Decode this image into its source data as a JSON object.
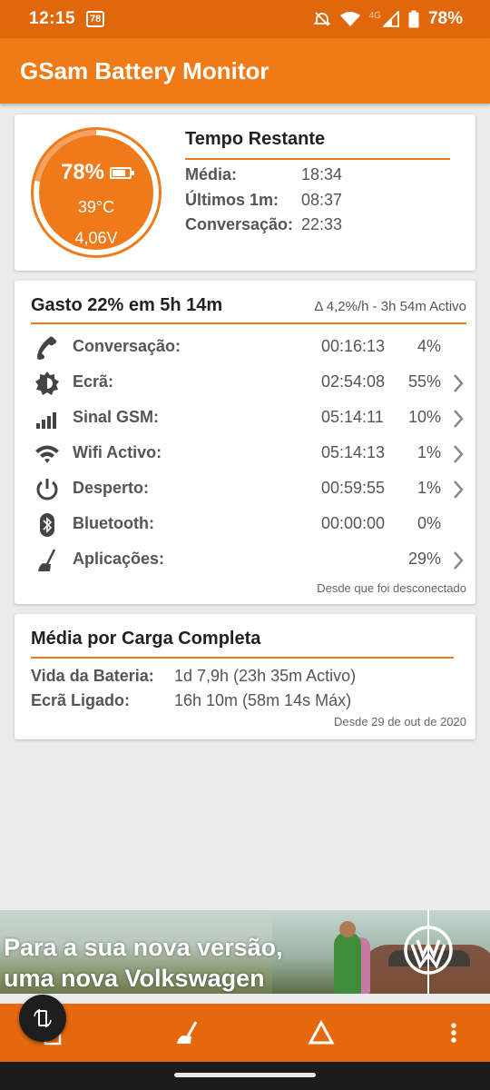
{
  "status_bar": {
    "time": "12:15",
    "notification_badge": "78",
    "network_label": "4G",
    "battery_percent": "78%"
  },
  "app_bar": {
    "title": "GSam Battery Monitor"
  },
  "battery_card": {
    "percent": "78%",
    "level_fraction": 0.78,
    "temperature": "39°C",
    "voltage": "4,06V",
    "title": "Tempo Restante",
    "rows": [
      {
        "label": "Média:",
        "value": "18:34"
      },
      {
        "label": "Últimos 1m:",
        "value": "08:37"
      },
      {
        "label": "Conversação:",
        "value": "22:33"
      }
    ]
  },
  "usage_card": {
    "title": "Gasto 22% em 5h 14m",
    "subtitle": "Δ 4,2%/h - 3h 54m Activo",
    "rows": [
      {
        "icon": "phone-icon",
        "label": "Conversação:",
        "duration": "00:16:13",
        "percent": "4%",
        "has_chevron": false
      },
      {
        "icon": "screen-brightness-icon",
        "label": "Ecrã:",
        "duration": "02:54:08",
        "percent": "55%",
        "has_chevron": true
      },
      {
        "icon": "signal-bars-icon",
        "label": "Sinal GSM:",
        "duration": "05:14:11",
        "percent": "10%",
        "has_chevron": true
      },
      {
        "icon": "wifi-icon",
        "label": "Wifi Activo:",
        "duration": "05:14:13",
        "percent": "1%",
        "has_chevron": true
      },
      {
        "icon": "power-icon",
        "label": "Desperto:",
        "duration": "00:59:55",
        "percent": "1%",
        "has_chevron": true
      },
      {
        "icon": "bluetooth-icon",
        "label": "Bluetooth:",
        "duration": "00:00:00",
        "percent": "0%",
        "has_chevron": false
      },
      {
        "icon": "apps-broom-icon",
        "label": "Aplicações:",
        "duration": "",
        "percent": "29%",
        "has_chevron": true
      }
    ],
    "footer": "Desde que foi desconectado"
  },
  "average_card": {
    "title": "Média por Carga Completa",
    "rows": [
      {
        "label": "Vida da Bateria:",
        "value": "1d 7,9h (23h 35m Activo)"
      },
      {
        "label": "Ecrã Ligado:",
        "value": "16h 10m (58m 14s Máx)"
      }
    ],
    "footer": "Desde 29 de out de 2020"
  },
  "ad_banner": {
    "line1": "Para a sua nova versão,",
    "line2": "uma nova Volkswagen",
    "logo": "volkswagen-logo"
  },
  "bottom_bar": {
    "buttons": [
      "rotate-icon",
      "apps-broom-icon",
      "delta-icon",
      "more-vert-icon"
    ]
  },
  "colors": {
    "accent": "#ef7a16",
    "status_bar": "#e0670c",
    "bottom_bar": "#e6680c"
  }
}
